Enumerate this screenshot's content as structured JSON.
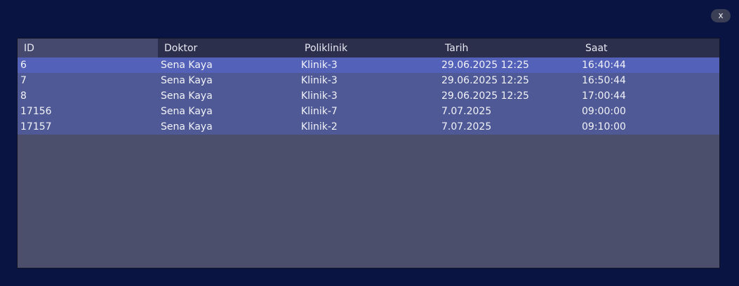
{
  "window": {
    "close_label": "x"
  },
  "table": {
    "columns": [
      "ID",
      "Doktor",
      "Poliklinik",
      "Tarih",
      "Saat"
    ],
    "rows": [
      [
        "6",
        "Sena Kaya",
        "Klinik-3",
        "29.06.2025 12:25",
        "16:40:44"
      ],
      [
        "7",
        "Sena Kaya",
        "Klinik-3",
        "29.06.2025 12:25",
        "16:50:44"
      ],
      [
        "8",
        "Sena Kaya",
        "Klinik-3",
        "29.06.2025 12:25",
        "17:00:44"
      ],
      [
        "17156",
        "Sena Kaya",
        "Klinik-7",
        "7.07.2025",
        "09:00:00"
      ],
      [
        "17157",
        "Sena Kaya",
        "Klinik-2",
        "7.07.2025",
        "09:10:00"
      ]
    ],
    "selected_row": 0
  },
  "colors": {
    "background": "#0a1442",
    "header": "#2b2f4c",
    "row": "#4f5996",
    "selected_row": "#5361b8",
    "empty_area": "#4c4f6b"
  }
}
